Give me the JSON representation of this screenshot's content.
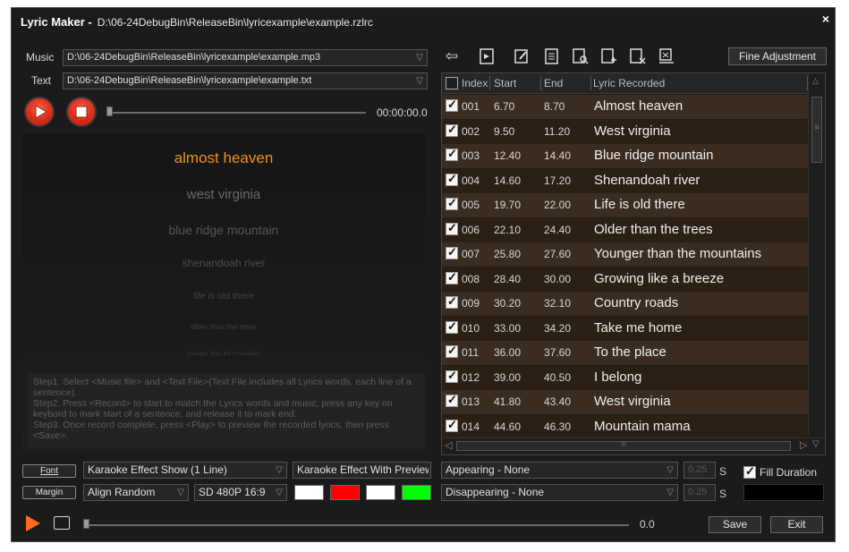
{
  "window": {
    "app_name": "Lyric Maker -",
    "project_path": "D:\\06-24DebugBin\\ReleaseBin\\lyricexample\\example.rzlrc",
    "close_glyph": "×"
  },
  "music": {
    "label": "Music",
    "value": "D:\\06-24DebugBin\\ReleaseBin\\lyricexample\\example.mp3"
  },
  "text": {
    "label": "Text",
    "value": "D:\\06-24DebugBin\\ReleaseBin\\lyricexample\\example.txt"
  },
  "player": {
    "time": "00:00:00.0",
    "progress": 0
  },
  "preview": {
    "current": "almost heaven",
    "upcoming": [
      "west virginia",
      "blue ridge mountain",
      "shenandoah river",
      "life is old there",
      "older than the trees",
      "younger than the mountains"
    ],
    "current_color": "#f0921e"
  },
  "steps": [
    "Step1. Select <Music file> and <Text File>(Text File includes all Lyrics words, each line of a sentence).",
    "Step2. Press <Record> to start to match the Lyrics words and music, press any key on keybord to mark start of a sentence, and release it to mark end.",
    "Step3. Once record complete, press <Play> to preview the recorded lyrics, then press <Save>."
  ],
  "toolbar": {
    "icons": [
      "back-arrow-icon",
      "import-icon",
      "edit-icon",
      "list-icon",
      "search-doc-icon",
      "add-doc-icon",
      "delete-doc-icon",
      "clear-doc-icon"
    ],
    "fine_adjustment": "Fine Adjustment"
  },
  "table": {
    "columns": [
      "Index",
      "Start",
      "End",
      "Lyric Recorded"
    ],
    "rows": [
      {
        "index": "001",
        "start": "6.70",
        "end": "8.70",
        "lyric": "Almost heaven"
      },
      {
        "index": "002",
        "start": "9.50",
        "end": "11.20",
        "lyric": "West virginia"
      },
      {
        "index": "003",
        "start": "12.40",
        "end": "14.40",
        "lyric": "Blue ridge mountain"
      },
      {
        "index": "004",
        "start": "14.60",
        "end": "17.20",
        "lyric": "Shenandoah river"
      },
      {
        "index": "005",
        "start": "19.70",
        "end": "22.00",
        "lyric": "Life is old there"
      },
      {
        "index": "006",
        "start": "22.10",
        "end": "24.40",
        "lyric": "Older than the trees"
      },
      {
        "index": "007",
        "start": "25.80",
        "end": "27.60",
        "lyric": "Younger than the mountains"
      },
      {
        "index": "008",
        "start": "28.40",
        "end": "30.00",
        "lyric": "Growing like a breeze"
      },
      {
        "index": "009",
        "start": "30.20",
        "end": "32.10",
        "lyric": "Country roads"
      },
      {
        "index": "010",
        "start": "33.00",
        "end": "34.20",
        "lyric": "Take me home"
      },
      {
        "index": "011",
        "start": "36.00",
        "end": "37.60",
        "lyric": "To the place"
      },
      {
        "index": "012",
        "start": "39.00",
        "end": "40.50",
        "lyric": "I belong"
      },
      {
        "index": "013",
        "start": "41.80",
        "end": "43.40",
        "lyric": "West virginia"
      },
      {
        "index": "014",
        "start": "44.60",
        "end": "46.30",
        "lyric": "Mountain mama"
      }
    ],
    "scroll_grip": "≡",
    "hscroll_grip": "III"
  },
  "settings": {
    "font_button": "Font",
    "margin_button": "Margin",
    "effect_show": "Karaoke Effect Show (1 Line)",
    "effect_preview": "Karaoke Effect With Preview",
    "align": "Align Random",
    "resolution": "SD 480P 16:9",
    "appearing": "Appearing - None",
    "disappearing": "Disappearing - None",
    "appear_duration": "0.25",
    "disappear_duration": "0.25",
    "unit": "S",
    "fill_duration_label": "Fill Duration",
    "fill_duration_checked": true,
    "swatch_colors": [
      "#ffffff",
      "#ff0000",
      "#ffffff",
      "#00ff00"
    ]
  },
  "bottom": {
    "time": "0.0",
    "save": "Save",
    "exit": "Exit"
  }
}
